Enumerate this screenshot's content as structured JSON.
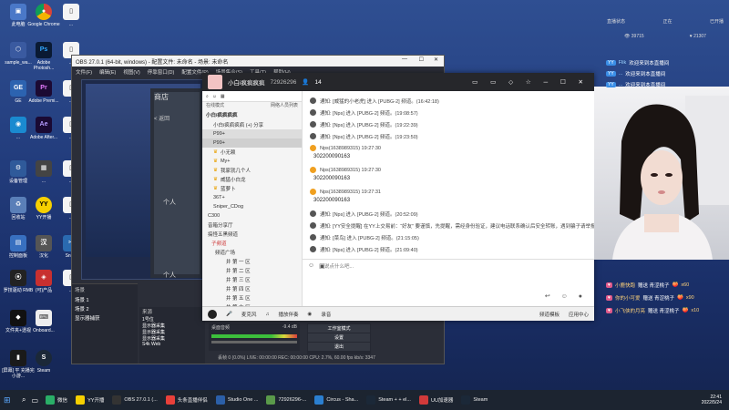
{
  "desktop": {
    "icons_col1": [
      "此电脑",
      "sample_wa...",
      "GE",
      "...",
      "设备管理",
      "回收站",
      "控制面板",
      "罗技驱动 RMB",
      "文件夹+透视"
    ],
    "icons_col2": [
      "Google Chrome",
      "Adobe Photosh...",
      "Adobe Premi...",
      "Adobe After...",
      "...",
      "YY开播",
      "汉化",
      "(可)产品",
      "Onboard..."
    ],
    "icons_col3": [
      "...",
      "...",
      "...",
      "...",
      "...",
      "...",
      "Snipe",
      "..."
    ],
    "bottom_icon_1": "Steam",
    "bottom_icon_2": "[屏幕] 平 充播完小游..."
  },
  "obs": {
    "title": "OBS 27.0.1 (64-bit, windows) - 配置文件: 未命名 - 场景: 未命名",
    "menu": [
      "文件(F)",
      "编辑(E)",
      "视图(V)",
      "停靠窗口(D)",
      "配置文件(P)",
      "场景集合(S)",
      "工具(T)",
      "帮助(H)"
    ],
    "store_label": "商店",
    "back_label": "< 返回",
    "scenes_header": "场景",
    "scenes": [
      "场景 1",
      "场景 2",
      "显示器捕获"
    ],
    "sources_header": "来源",
    "sources": [
      "1号位",
      "显示器采集",
      "显示器采集",
      "显示器采集",
      "S4k Web"
    ],
    "mixer_label": "桌面音频",
    "mixer_db": "-9.4 dB",
    "controls": [
      "工作室模式",
      "设置",
      "退出"
    ],
    "status": "丢帧 0 (0.0%)   LIVE: 00:00:00   REC: 00:00:00   CPU: 2.7%, 60.00 fps   kb/s: 3347",
    "people_label": "个人",
    "people_label2": "个人"
  },
  "chat": {
    "room_title": "小白i疯疯疯疯",
    "room_id": "72926296",
    "viewer_count": "14",
    "left_tab": "在线模式",
    "left_tab_right": "网络人员列表",
    "group_name": "小白i疯疯疯疯",
    "members": [
      "小白i疯疯疯疯 (+) 分享",
      "P99+",
      "P99+",
      "小无赖",
      "My+",
      "我家就几个人",
      "威猛小白龙",
      "蓝萝卜",
      "36T+",
      "Sniper_CDog"
    ],
    "channels": [
      "C300",
      "音箱分享厅",
      "搞怪五黑频道"
    ],
    "sub_channels": [
      "子频道",
      "频道广场"
    ],
    "rooms": [
      "井 第 一 区",
      "井 第 二 区",
      "井 第 三 区",
      "井 第 四 区",
      "井 第 五 区",
      "井 第 六 区"
    ],
    "messages": [
      {
        "type": "normal",
        "text": "通知: [威猛的小老虎] 进入 [PUBG-2] 频道。(16:42:18)"
      },
      {
        "type": "normal",
        "text": "通知: [Nps] 进入 [PUBG-2] 频道。(19:08:57)"
      },
      {
        "type": "normal",
        "text": "通知: [Nps] 进入 [PUBG-2] 频道。(19:22:39)"
      },
      {
        "type": "normal",
        "text": "通知: [Nps] 进入 [PUBG-2] 频道。(19:23:50)"
      },
      {
        "type": "warn",
        "text": "Nps(1638989315) 19:27:30"
      },
      {
        "type": "number",
        "text": "302200090163"
      },
      {
        "type": "warn",
        "text": "Nps(1638989315) 19:27:30"
      },
      {
        "type": "number",
        "text": "302200090163"
      },
      {
        "type": "warn",
        "text": "Nps(1638989315) 19:27:31"
      },
      {
        "type": "number",
        "text": "302200090163"
      },
      {
        "type": "normal",
        "text": "通知: [Nps] 进入 [PUBG-2] 频道。(20:52:09)"
      },
      {
        "type": "normal",
        "text": "通知: [YY安全提醒] 在YY上交易前：“好友” 要谨慎，先提醒，需经身份验证，建议电话联系确认后安全转账，遇到骗子请举报"
      },
      {
        "type": "normal",
        "text": "通知: [菜鸟] 进入 [PUBG-2] 频道。(21:15:05)"
      },
      {
        "type": "normal",
        "text": "通知: [Nps] 进入 [PUBG-2] 频道。(21:09:40)"
      },
      {
        "type": "normal",
        "text": "通知: [吐吐了个虹] 进入 [PUBG-2] 频道。(22:38:21)"
      }
    ],
    "input_placeholder": "说点什么吧...",
    "bottom_bar": [
      "频道模板",
      "应用中心"
    ],
    "footer_icons": [
      "麦克风",
      "播放伴奏",
      "录音"
    ]
  },
  "right_panel": {
    "top_label1": "直播状态",
    "top_label2": "正在",
    "top_label3": "已开播",
    "count1": "39715",
    "count2": "21307",
    "chat_rows": [
      {
        "tag": "YY",
        "name": "Flik",
        "text": "欢迎来到本直播间"
      },
      {
        "tag": "YY",
        "name": "...",
        "text": "欢迎来到本直播间"
      },
      {
        "tag": "YY",
        "name": "...",
        "text": "欢迎来到本直播间"
      }
    ],
    "gift_rows": [
      {
        "name": "小鹿快跑",
        "text": "赠送 青涩桃子",
        "count": "x60"
      },
      {
        "name": "你的小可爱",
        "text": "赠送 青涩桃子",
        "count": "x90"
      },
      {
        "name": "小飞侠的月亮",
        "text": "赠送 青涩桃子",
        "count": "x10"
      }
    ]
  },
  "taskbar": {
    "items": [
      "微信",
      "YY开播",
      "OBS 27.0.1 (...",
      "头条直播伴侣",
      "Studio One ...",
      "72926296-...",
      "Circus - Sha...",
      "Steam + + el...",
      "UU加速器",
      "Steam"
    ],
    "time": "22:41",
    "date": "2022/5/24"
  }
}
